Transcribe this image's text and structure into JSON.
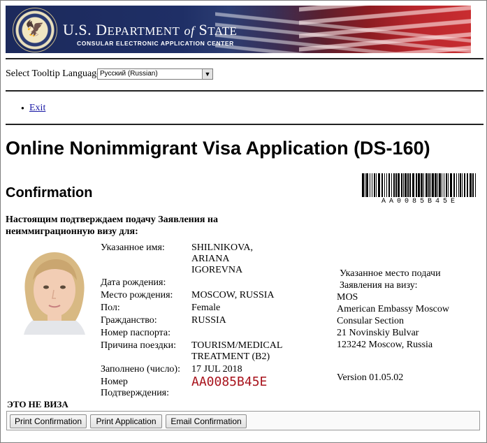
{
  "banner": {
    "title_main_1": "U.S. D",
    "title_caps_1": "EPARTMENT",
    "title_of": "of",
    "title_main_2": "S",
    "title_caps_2": "TATE",
    "subtitle": "CONSULAR ELECTRONIC APPLICATION CENTER",
    "seal_icon": "us-seal-icon"
  },
  "language": {
    "label": "Select Tooltip Language",
    "selected": "Русский (Russian)"
  },
  "nav": {
    "exit": "Exit"
  },
  "page_title": "Online Nonimmigrant Visa Application (DS-160)",
  "section_title": "Confirmation",
  "barcode": {
    "text": "AA0085B45E"
  },
  "intro": "Настоящим подтверждаем подачу Заявления на неиммиграционную визу для:",
  "applicant": {
    "name_label": "Указанное имя:",
    "name_value": "SHILNIKOVA, ARIANA IGOREVNA",
    "dob_label": "Дата рождения:",
    "dob_value": "",
    "pob_label": "Место рождения:",
    "pob_value": "MOSCOW, RUSSIA",
    "sex_label": "Пол:",
    "sex_value": "Female",
    "citizenship_label": "Гражданство:",
    "citizenship_value": "RUSSIA",
    "passport_label": "Номер паспорта:",
    "passport_value": "",
    "purpose_label": "Причина поездки:",
    "purpose_value": "TOURISM/MEDICAL TREATMENT (B2)",
    "completed_label": "Заполнено (число):",
    "completed_value": "17 JUL 2018",
    "confirmation_label": "Номер Подтверждения:",
    "confirmation_value": "AA0085B45E"
  },
  "submission": {
    "heading": "Указанное место подачи Заявления на визу:",
    "code": "MOS",
    "line1": "American Embassy Moscow",
    "line2": "Consular Section",
    "line3": "21 Novinskiy Bulvar",
    "line4": "123242 Moscow, Russia"
  },
  "version": "Version 01.05.02",
  "not_visa": "ЭТО НЕ ВИЗА",
  "buttons": {
    "print_confirmation": "Print Confirmation",
    "print_application": "Print Application",
    "email_confirmation": "Email Confirmation"
  },
  "colors": {
    "banner_blue": "#1c2a5c",
    "banner_red": "#b8262c",
    "confirmation_red": "#a8131c",
    "link_blue": "#1a1aa6"
  }
}
